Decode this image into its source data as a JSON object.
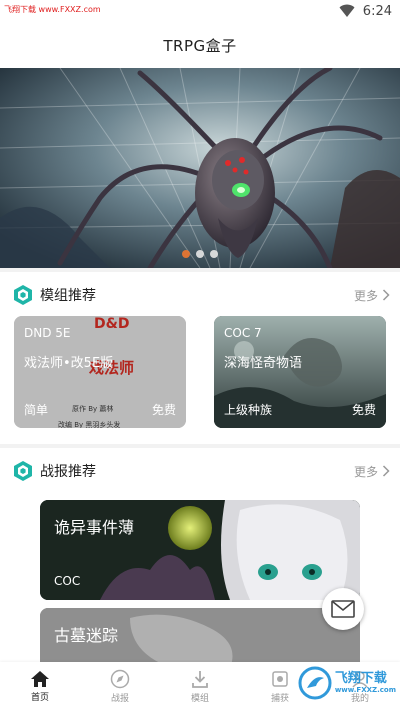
{
  "status": {
    "watermark": "飞翔下载 www.FXXZ.com",
    "time": "6:24"
  },
  "header": {
    "title": "TRPG盒子"
  },
  "banner": {
    "slides": 3,
    "active": 1
  },
  "modules": {
    "title": "模组推荐",
    "more": "更多",
    "cards": [
      {
        "tag": "DND 5E",
        "name": "戏法师•改5E版",
        "cover_title": "D&D",
        "cover_subtitle": "戏法师",
        "left": "简单",
        "right": "免费",
        "note1": "原作 By 蕭林",
        "note2": "改编 By 黑羽乡头发"
      },
      {
        "tag": "COC 7",
        "name": "深海怪奇物语",
        "left": "上级种族",
        "right": "免费"
      }
    ]
  },
  "reports": {
    "title": "战报推荐",
    "more": "更多",
    "items": [
      {
        "title": "诡异事件薄",
        "sub": "COC"
      },
      {
        "title": "古墓迷踪",
        "sub": ""
      }
    ]
  },
  "nav": [
    {
      "label": "首页",
      "icon": "home-icon",
      "active": true
    },
    {
      "label": "战报",
      "icon": "compass-icon",
      "active": false
    },
    {
      "label": "模组",
      "icon": "download-icon",
      "active": false
    },
    {
      "label": "捕获",
      "icon": "capture-icon",
      "active": false
    },
    {
      "label": "我的",
      "icon": "user-icon",
      "active": false
    }
  ],
  "corner_watermark": {
    "line1": "飞翔下载",
    "line2": "www.FXXZ.com"
  },
  "colors": {
    "accent": "#f07830",
    "teal": "#1fb5a8",
    "active_nav": "#222222"
  }
}
